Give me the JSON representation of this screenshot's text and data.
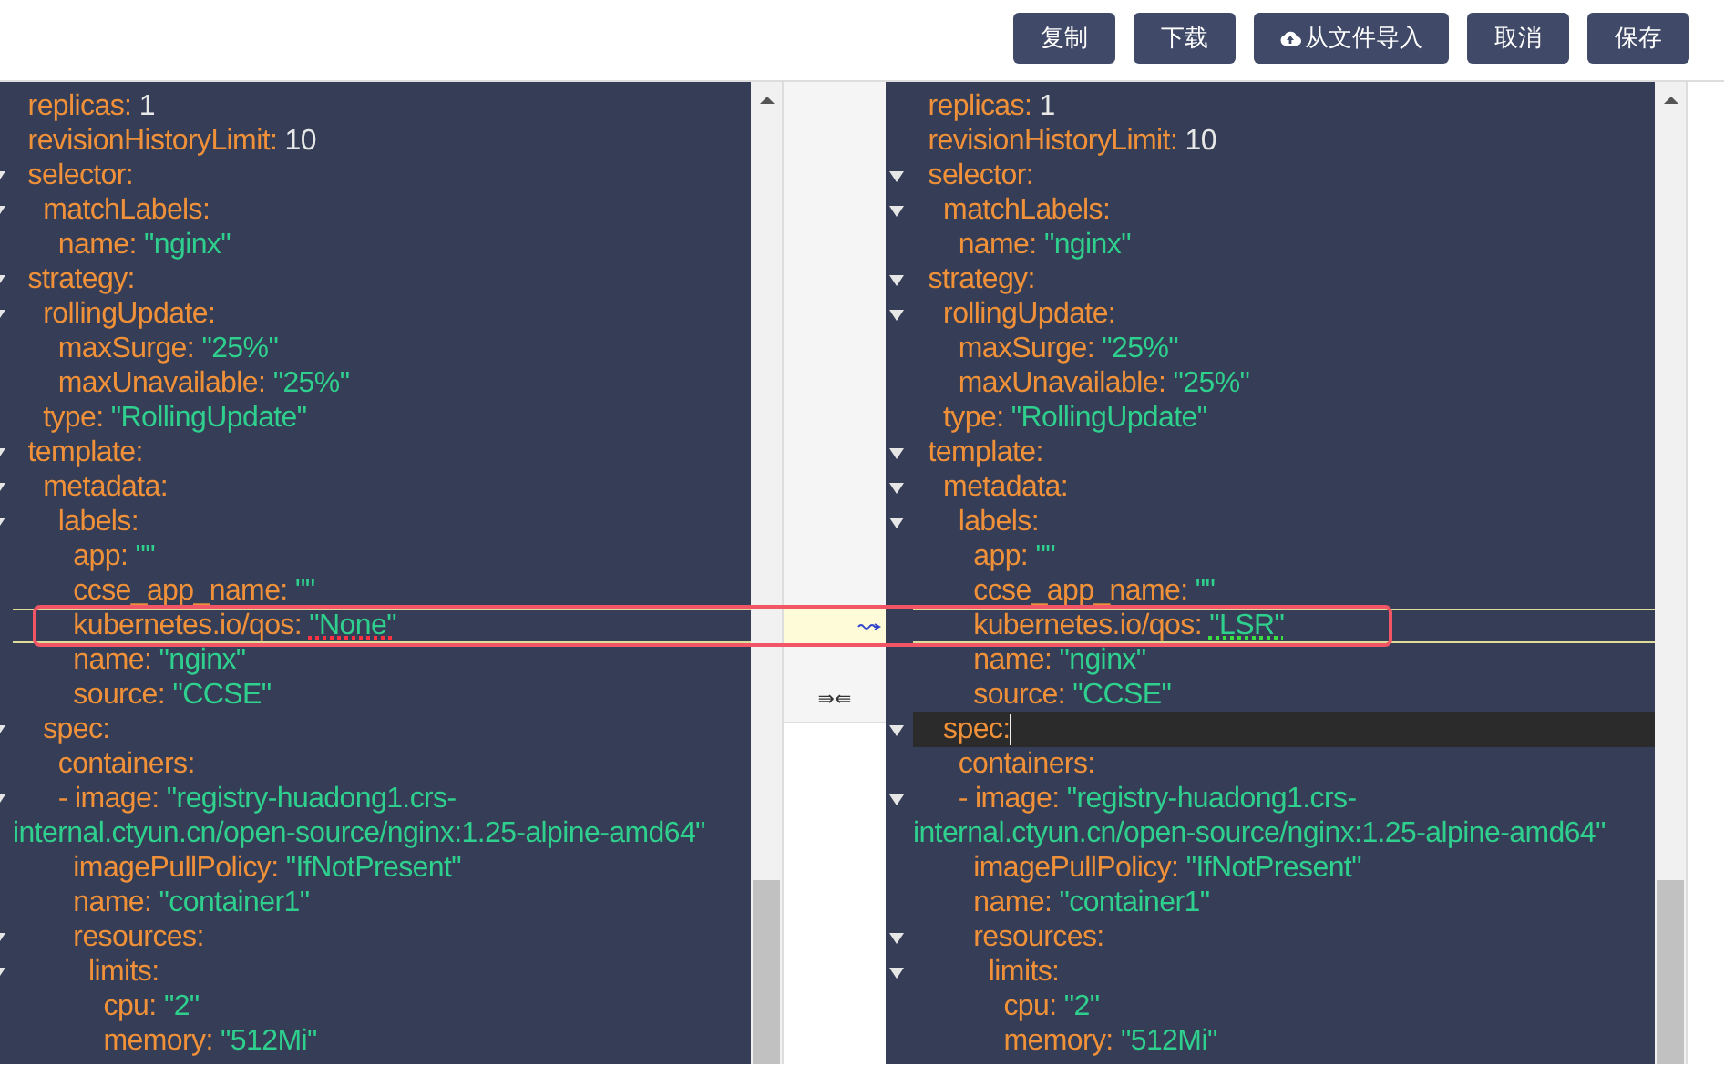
{
  "toolbar": {
    "buttons": [
      {
        "label": "复制",
        "kind": "plain"
      },
      {
        "label": "下载",
        "kind": "plain"
      },
      {
        "label": "从文件导入",
        "kind": "upload"
      },
      {
        "label": "取消",
        "kind": "plain"
      },
      {
        "label": "保存",
        "kind": "plain"
      }
    ]
  },
  "left_editor": {
    "lines": [
      {
        "text": "  replicas: ",
        "value": "1",
        "kind": "number",
        "foldable": false,
        "changed": false,
        "cursor": false
      },
      {
        "text": "  revisionHistoryLimit: ",
        "value": "10",
        "kind": "number",
        "foldable": false,
        "changed": false,
        "cursor": false
      },
      {
        "text": "  selector:",
        "kind": "key",
        "foldable": true,
        "changed": false,
        "cursor": false
      },
      {
        "text": "    matchLabels:",
        "kind": "key",
        "foldable": true,
        "changed": false,
        "cursor": false
      },
      {
        "text": "      name: ",
        "value": "\"nginx\"",
        "kind": "string",
        "foldable": false,
        "changed": false,
        "cursor": false
      },
      {
        "text": "  strategy:",
        "kind": "key",
        "foldable": true,
        "changed": false,
        "cursor": false
      },
      {
        "text": "    rollingUpdate:",
        "kind": "key",
        "foldable": true,
        "changed": false,
        "cursor": false
      },
      {
        "text": "      maxSurge: ",
        "value": "\"25%\"",
        "kind": "string",
        "foldable": false,
        "changed": false,
        "cursor": false
      },
      {
        "text": "      maxUnavailable: ",
        "value": "\"25%\"",
        "kind": "string",
        "foldable": false,
        "changed": false,
        "cursor": false
      },
      {
        "text": "    type: ",
        "value": "\"RollingUpdate\"",
        "kind": "string",
        "foldable": false,
        "changed": false,
        "cursor": false
      },
      {
        "text": "  template:",
        "kind": "key",
        "foldable": true,
        "changed": false,
        "cursor": false
      },
      {
        "text": "    metadata:",
        "kind": "key",
        "foldable": true,
        "changed": false,
        "cursor": false
      },
      {
        "text": "      labels:",
        "kind": "key",
        "foldable": true,
        "changed": false,
        "cursor": false
      },
      {
        "text": "        app: ",
        "value": "\"\"",
        "kind": "string",
        "foldable": false,
        "changed": false,
        "cursor": false
      },
      {
        "text": "        ccse_app_name: ",
        "value": "\"\"",
        "kind": "string",
        "foldable": false,
        "changed": false,
        "cursor": false
      },
      {
        "text": "        kubernetes.io/qos: ",
        "value": "\"None\"",
        "kind": "string",
        "foldable": false,
        "changed": true,
        "cursor": false
      },
      {
        "text": "        name: ",
        "value": "\"nginx\"",
        "kind": "string",
        "foldable": false,
        "changed": false,
        "cursor": false
      },
      {
        "text": "        source: ",
        "value": "\"CCSE\"",
        "kind": "string",
        "foldable": false,
        "changed": false,
        "cursor": false
      },
      {
        "text": "    spec:",
        "kind": "key",
        "foldable": true,
        "changed": false,
        "cursor": false
      },
      {
        "text": "      containers:",
        "kind": "key",
        "foldable": false,
        "changed": false,
        "cursor": false
      },
      {
        "text": "      - image: ",
        "value": "\"registry-huadong1.crs-",
        "kind": "string",
        "foldable": true,
        "changed": false,
        "cursor": false
      },
      {
        "value": "internal.ctyun.cn/open-source/nginx:1.25-alpine-amd64\"",
        "kind": "string",
        "foldable": false,
        "changed": false,
        "cursor": false
      },
      {
        "text": "        imagePullPolicy: ",
        "value": "\"IfNotPresent\"",
        "kind": "string",
        "foldable": false,
        "changed": false,
        "cursor": false
      },
      {
        "text": "        name: ",
        "value": "\"container1\"",
        "kind": "string",
        "foldable": false,
        "changed": false,
        "cursor": false
      },
      {
        "text": "        resources:",
        "kind": "key",
        "foldable": true,
        "changed": false,
        "cursor": false
      },
      {
        "text": "          limits:",
        "kind": "key",
        "foldable": true,
        "changed": false,
        "cursor": false
      },
      {
        "text": "            cpu: ",
        "value": "\"2\"",
        "kind": "string",
        "foldable": false,
        "changed": false,
        "cursor": false
      },
      {
        "text": "            memory: ",
        "value": "\"512Mi\"",
        "kind": "string",
        "foldable": false,
        "changed": false,
        "cursor": false
      }
    ]
  },
  "merge_gutter": {
    "merge_label": "⇛⇚"
  },
  "right_editor": {
    "lines": [
      {
        "text": "  replicas: ",
        "value": "1",
        "kind": "number",
        "foldable": false,
        "changed": false,
        "cursor": false
      },
      {
        "text": "  revisionHistoryLimit: ",
        "value": "10",
        "kind": "number",
        "foldable": false,
        "changed": false,
        "cursor": false
      },
      {
        "text": "  selector:",
        "kind": "key",
        "foldable": true,
        "changed": false,
        "cursor": false
      },
      {
        "text": "    matchLabels:",
        "kind": "key",
        "foldable": true,
        "changed": false,
        "cursor": false
      },
      {
        "text": "      name: ",
        "value": "\"nginx\"",
        "kind": "string",
        "foldable": false,
        "changed": false,
        "cursor": false
      },
      {
        "text": "  strategy:",
        "kind": "key",
        "foldable": true,
        "changed": false,
        "cursor": false
      },
      {
        "text": "    rollingUpdate:",
        "kind": "key",
        "foldable": true,
        "changed": false,
        "cursor": false
      },
      {
        "text": "      maxSurge: ",
        "value": "\"25%\"",
        "kind": "string",
        "foldable": false,
        "changed": false,
        "cursor": false
      },
      {
        "text": "      maxUnavailable: ",
        "value": "\"25%\"",
        "kind": "string",
        "foldable": false,
        "changed": false,
        "cursor": false
      },
      {
        "text": "    type: ",
        "value": "\"RollingUpdate\"",
        "kind": "string",
        "foldable": false,
        "changed": false,
        "cursor": false
      },
      {
        "text": "  template:",
        "kind": "key",
        "foldable": true,
        "changed": false,
        "cursor": false
      },
      {
        "text": "    metadata:",
        "kind": "key",
        "foldable": true,
        "changed": false,
        "cursor": false
      },
      {
        "text": "      labels:",
        "kind": "key",
        "foldable": true,
        "changed": false,
        "cursor": false
      },
      {
        "text": "        app: ",
        "value": "\"\"",
        "kind": "string",
        "foldable": false,
        "changed": false,
        "cursor": false
      },
      {
        "text": "        ccse_app_name: ",
        "value": "\"\"",
        "kind": "string",
        "foldable": false,
        "changed": false,
        "cursor": false
      },
      {
        "text": "        kubernetes.io/qos: ",
        "value": "\"LSR\"",
        "kind": "string",
        "foldable": false,
        "changed": true,
        "cursor": false
      },
      {
        "text": "        name: ",
        "value": "\"nginx\"",
        "kind": "string",
        "foldable": false,
        "changed": false,
        "cursor": false
      },
      {
        "text": "        source: ",
        "value": "\"CCSE\"",
        "kind": "string",
        "foldable": false,
        "changed": false,
        "cursor": false
      },
      {
        "text": "    spec:",
        "kind": "key",
        "foldable": true,
        "changed": false,
        "cursor": true
      },
      {
        "text": "      containers:",
        "kind": "key",
        "foldable": false,
        "changed": false,
        "cursor": false
      },
      {
        "text": "      - image: ",
        "value": "\"registry-huadong1.crs-",
        "kind": "string",
        "foldable": true,
        "changed": false,
        "cursor": false
      },
      {
        "value": "internal.ctyun.cn/open-source/nginx:1.25-alpine-amd64\"",
        "kind": "string",
        "foldable": false,
        "changed": false,
        "cursor": false
      },
      {
        "text": "        imagePullPolicy: ",
        "value": "\"IfNotPresent\"",
        "kind": "string",
        "foldable": false,
        "changed": false,
        "cursor": false
      },
      {
        "text": "        name: ",
        "value": "\"container1\"",
        "kind": "string",
        "foldable": false,
        "changed": false,
        "cursor": false
      },
      {
        "text": "        resources:",
        "kind": "key",
        "foldable": true,
        "changed": false,
        "cursor": false
      },
      {
        "text": "          limits:",
        "kind": "key",
        "foldable": true,
        "changed": false,
        "cursor": false
      },
      {
        "text": "            cpu: ",
        "value": "\"2\"",
        "kind": "string",
        "foldable": false,
        "changed": false,
        "cursor": false
      },
      {
        "text": "            memory: ",
        "value": "\"512Mi\"",
        "kind": "string",
        "foldable": false,
        "changed": false,
        "cursor": false
      }
    ]
  },
  "highlight_box": true
}
